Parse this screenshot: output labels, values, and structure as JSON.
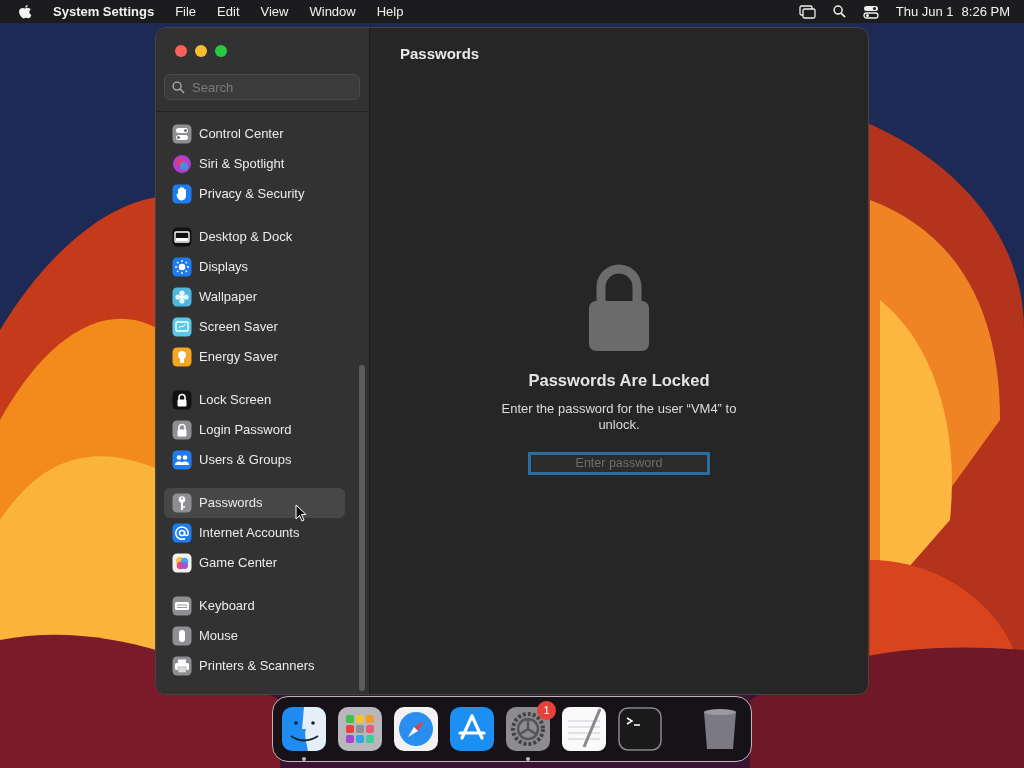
{
  "menu_bar": {
    "app_name": "System Settings",
    "menus": [
      "File",
      "Edit",
      "View",
      "Window",
      "Help"
    ],
    "date": "Thu Jun 1",
    "time": "8:26 PM"
  },
  "window": {
    "title": "Passwords",
    "search": {
      "placeholder": "Search"
    },
    "sidebar": {
      "groups": [
        {
          "items": [
            {
              "label": "Control Center",
              "color": "#8e8e93",
              "selected": false
            },
            {
              "label": "Siri & Spotlight",
              "color": "#b03fd0",
              "selected": false
            },
            {
              "label": "Privacy & Security",
              "color": "#1f7cf0",
              "selected": false
            }
          ]
        },
        {
          "items": [
            {
              "label": "Desktop & Dock",
              "color": "#111111",
              "selected": false
            },
            {
              "label": "Displays",
              "color": "#1f7cf0",
              "selected": false
            },
            {
              "label": "Wallpaper",
              "color": "#4fb8e0",
              "selected": false
            },
            {
              "label": "Screen Saver",
              "color": "#5ac8e8",
              "selected": false
            },
            {
              "label": "Energy Saver",
              "color": "#f5a623",
              "selected": false
            }
          ]
        },
        {
          "items": [
            {
              "label": "Lock Screen",
              "color": "#111111",
              "selected": false
            },
            {
              "label": "Login Password",
              "color": "#8e8e93",
              "selected": false
            },
            {
              "label": "Users & Groups",
              "color": "#1f7cf0",
              "selected": false
            }
          ]
        },
        {
          "items": [
            {
              "label": "Passwords",
              "color": "#8e8e93",
              "selected": true
            },
            {
              "label": "Internet Accounts",
              "color": "#1f7cf0",
              "selected": false
            },
            {
              "label": "Game Center",
              "color": "#f2f2f2",
              "selected": false
            }
          ]
        },
        {
          "items": [
            {
              "label": "Keyboard",
              "color": "#8e8e93",
              "selected": false
            },
            {
              "label": "Mouse",
              "color": "#8e8e93",
              "selected": false
            },
            {
              "label": "Printers & Scanners",
              "color": "#8e8e93",
              "selected": false
            }
          ]
        }
      ]
    }
  },
  "locked_panel": {
    "heading": "Passwords Are Locked",
    "message": "Enter the password for the user “VM4” to unlock.",
    "password_field": {
      "placeholder": "Enter password"
    }
  },
  "dock": {
    "apps": [
      {
        "running": true
      },
      {
        "running": false
      },
      {
        "running": false
      },
      {
        "running": false
      },
      {
        "running": true,
        "badge": "1"
      },
      {
        "running": false
      },
      {
        "running": false
      }
    ]
  }
}
